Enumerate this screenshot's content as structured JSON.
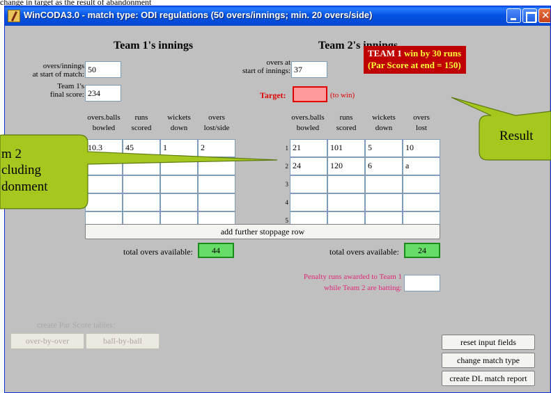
{
  "top_caption": "change in target as the result of abandonment",
  "window": {
    "title": "WinCODA3.0 - match type: ODI regulations (50 overs/innings; min. 20 overs/side)"
  },
  "team1": {
    "heading": "Team 1's innings",
    "overs_label_1": "overs/innings",
    "overs_label_2": "at start of match:",
    "overs_value": "50",
    "score_label_1": "Team 1's",
    "score_label_2": "final score:",
    "score_value": "234",
    "columns": [
      {
        "line1": "overs.balls",
        "line2": "bowled"
      },
      {
        "line1": "runs",
        "line2": "scored"
      },
      {
        "line1": "wickets",
        "line2": "down"
      },
      {
        "line1": "overs",
        "line2": "lost/side"
      }
    ],
    "rows": [
      [
        "10.3",
        "45",
        "1",
        "2"
      ],
      [
        "",
        "",
        "",
        ""
      ],
      [
        "",
        "",
        "",
        ""
      ],
      [
        "",
        "",
        "",
        ""
      ],
      [
        "",
        "",
        "",
        ""
      ]
    ],
    "total_label": "total overs available:",
    "total_value": "44"
  },
  "team2": {
    "heading": "Team 2's innings",
    "overs_label_1": "overs at",
    "overs_label_2": "start of innings:",
    "overs_value": "37",
    "target_label": "Target:",
    "target_value": "",
    "target_suffix": "(to win)",
    "columns": [
      {
        "line1": "overs.balls",
        "line2": "bowled"
      },
      {
        "line1": "runs",
        "line2": "scored"
      },
      {
        "line1": "wickets",
        "line2": "down"
      },
      {
        "line1": "overs",
        "line2": "lost"
      }
    ],
    "row_numbers": [
      "1",
      "2",
      "3",
      "4",
      "5"
    ],
    "rows": [
      [
        "21",
        "101",
        "5",
        "10"
      ],
      [
        "24",
        "120",
        "6",
        "a"
      ],
      [
        "",
        "",
        "",
        ""
      ],
      [
        "",
        "",
        "",
        ""
      ],
      [
        "",
        "",
        "",
        ""
      ]
    ],
    "total_label": "total overs available:",
    "total_value": "24"
  },
  "result": {
    "team": "TEAM 1",
    "text": " win by 30 runs",
    "par": "(Par Score at end = 150)"
  },
  "add_row_button": "add further stoppage row",
  "penalty": {
    "line1": "Penalty runs awarded to Team 1",
    "line2": "while Team 2 are batting:",
    "value": ""
  },
  "par_tables": {
    "label": "create Par Score tables:",
    "over_by_over": "over-by-over",
    "ball_by_ball": "ball-by-ball"
  },
  "actions": {
    "reset": "reset input fields",
    "change_match": "change match type",
    "report": "create DL match report"
  },
  "callouts": {
    "left_line1": "m 2",
    "left_line2": "cluding",
    "left_line3": "donment",
    "right": "Result"
  },
  "colors": {
    "title_bar": "#0554e3",
    "result_bg": "#c00000",
    "target_bg": "#ff9a9a",
    "total_bg": "#66dd66",
    "penalty_text": "#e0287a",
    "callout_fill": "#a6c81e"
  }
}
